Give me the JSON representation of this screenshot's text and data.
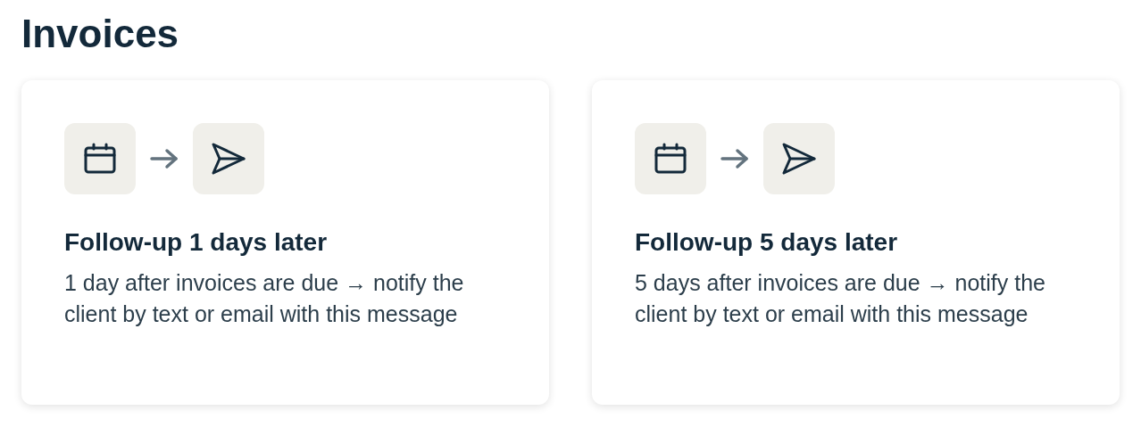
{
  "title": "Invoices",
  "cards": [
    {
      "heading": "Follow-up 1 days later",
      "description": "1 day after invoices are due → notify the client by text or email with this message"
    },
    {
      "heading": "Follow-up 5 days later",
      "description": "5 days after invoices are due → notify the client by text or email with this message"
    }
  ]
}
